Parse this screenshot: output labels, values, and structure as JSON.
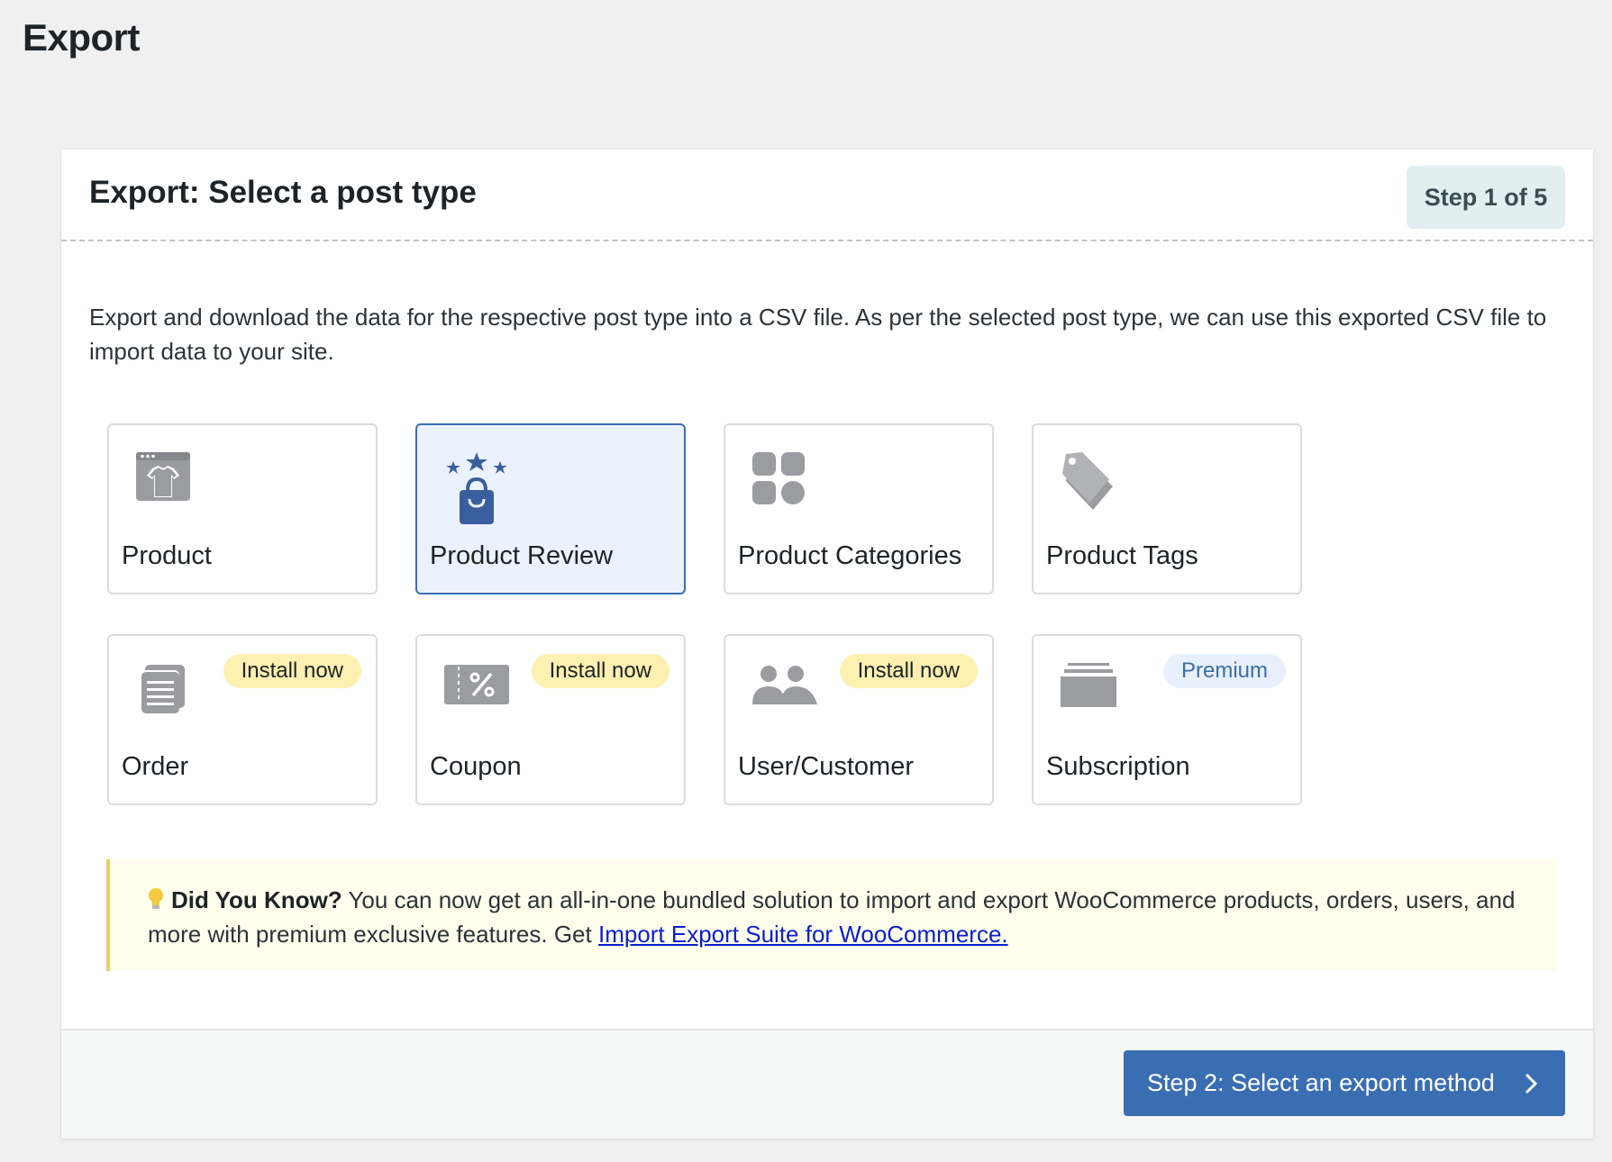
{
  "page": {
    "title": "Export"
  },
  "panel": {
    "title": "Export: Select a post type",
    "step_label": "Step 1 of 5",
    "description": "Export and download the data for the respective post type into a CSV file. As per the selected post type, we can use this exported CSV file to import data to your site."
  },
  "post_types": [
    {
      "label": "Product",
      "icon": "shirt-icon",
      "selected": false,
      "badge": ""
    },
    {
      "label": "Product Review",
      "icon": "review-bag-icon",
      "selected": true,
      "badge": ""
    },
    {
      "label": "Product Categories",
      "icon": "categories-icon",
      "selected": false,
      "badge": ""
    },
    {
      "label": "Product Tags",
      "icon": "tag-icon",
      "selected": false,
      "badge": ""
    },
    {
      "label": "Order",
      "icon": "order-icon",
      "selected": false,
      "badge": "Install now"
    },
    {
      "label": "Coupon",
      "icon": "coupon-icon",
      "selected": false,
      "badge": "Install now"
    },
    {
      "label": "User/Customer",
      "icon": "users-icon",
      "selected": false,
      "badge": "Install now"
    },
    {
      "label": "Subscription",
      "icon": "subscription-icon",
      "selected": false,
      "badge": "Premium"
    }
  ],
  "notice": {
    "heading": "Did You Know?",
    "text": "You can now get an all-in-one bundled solution to import and export WooCommerce products, orders, users, and more with premium exclusive features. Get",
    "link_text": "Import Export Suite for WooCommerce."
  },
  "footer": {
    "next_button": "Step 2: Select an export method"
  },
  "colors": {
    "accent": "#3a6eb2",
    "selected_bg": "#eaf2fd",
    "install_badge": "#fdf0b0",
    "premium_badge": "#e8f0fb",
    "notice_bg": "#fffdeb"
  }
}
